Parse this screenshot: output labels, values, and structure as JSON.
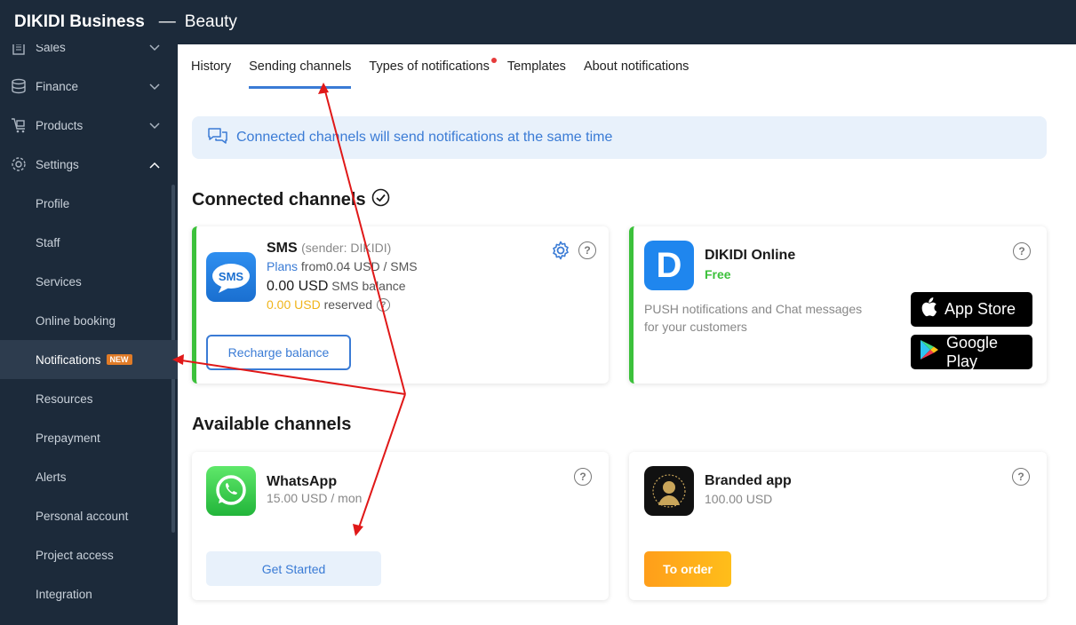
{
  "topbar": {
    "brand": "DIKIDI Business",
    "separator": "—",
    "workspace": "Beauty"
  },
  "sidebar": {
    "items": [
      {
        "label": "Sales",
        "icon": "receipt-icon"
      },
      {
        "label": "Finance",
        "icon": "coins-icon"
      },
      {
        "label": "Products",
        "icon": "cart-icon"
      },
      {
        "label": "Settings",
        "icon": "gear-icon"
      }
    ],
    "sub": [
      "Profile",
      "Staff",
      "Services",
      "Online booking",
      "Notifications",
      "Resources",
      "Prepayment",
      "Alerts",
      "Personal account",
      "Project access",
      "Integration"
    ],
    "new_badge": "NEW"
  },
  "tabs": [
    "History",
    "Sending channels",
    "Types of notifications",
    "Templates",
    "About notifications"
  ],
  "banner": {
    "text": "Connected channels will send notifications at the same time"
  },
  "connected": {
    "title": "Connected channels",
    "sms": {
      "name": "SMS",
      "sender": "(sender: DIKIDI)",
      "plans_link": "Plans",
      "plans_rest": "from0.04 USD / SMS",
      "balance": "0.00 USD",
      "balance_label": "SMS balance",
      "reserved_amount": "0.00 USD",
      "reserved_label": "reserved",
      "icon_text": "SMS",
      "button": "Recharge balance"
    },
    "dikidi": {
      "name": "DIKIDI Online",
      "price": "Free",
      "icon_letter": "D",
      "desc1": "PUSH notifications and Chat messages",
      "desc2": "for your customers",
      "app_store": "App Store",
      "google_play": "Google Play"
    }
  },
  "available": {
    "title": "Available channels",
    "whatsapp": {
      "name": "WhatsApp",
      "price": "15.00 USD / mon",
      "button": "Get Started"
    },
    "branded": {
      "name": "Branded app",
      "price": "100.00 USD",
      "button": "To order"
    }
  },
  "help_glyph": "?",
  "colors": {
    "accent": "#3a7bd5",
    "green": "#3cc13b",
    "orange": "#ffa51a",
    "sidebar": "#1c2a3a",
    "annotation": "#e01818"
  }
}
